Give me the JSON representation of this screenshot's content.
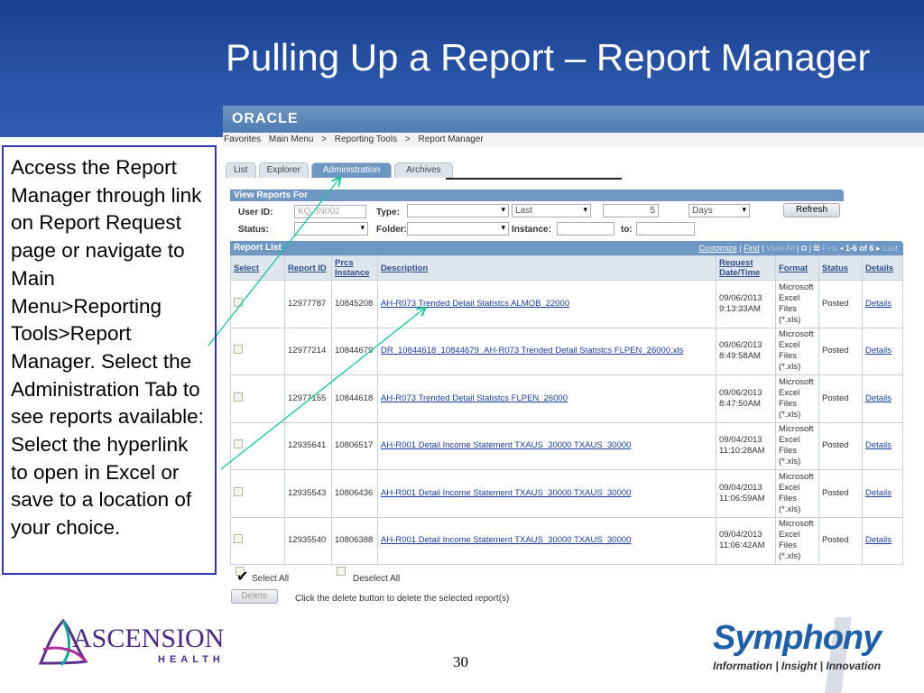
{
  "slide": {
    "title": "Pulling Up a Report – Report Manager",
    "page_number": "30",
    "callout": "Access the Report Manager through link on Report Request page or navigate to Main Menu>Reporting Tools>Report Manager. Select the Administration Tab to see reports available: Select the hyperlink to open in Excel or save to a location of your choice.",
    "logo_left": "ASCENSION HEALTH",
    "logo_left_main": "ASCENSION",
    "logo_left_sub": "HEALTH",
    "logo_right": "Symphony",
    "logo_right_tagline": "Information | Insight | Innovation"
  },
  "app": {
    "logo": "ORACLE",
    "breadcrumb": [
      "Favorites",
      "Main Menu",
      ">",
      "Reporting Tools",
      ">",
      "Report Manager"
    ],
    "tabs": [
      "List",
      "Explorer",
      "Administration",
      "Archives"
    ],
    "view_reports_for": {
      "title": "View Reports For",
      "user_id_label": "User ID:",
      "user_id": "KQ..IN002",
      "type_label": "Type:",
      "type": "",
      "last": "Last",
      "last_value": "5",
      "unit": "Days",
      "refresh": "Refresh",
      "status_label": "Status:",
      "status": "",
      "folder_label": "Folder:",
      "folder": "",
      "instance_label": "Instance:",
      "to_label": "to:"
    },
    "report_list": {
      "title": "Report List",
      "customize": "Customize",
      "find": "Find",
      "view_all": "View All",
      "first": "First",
      "range": "1-6 of 6",
      "last": "Last",
      "columns": [
        "Select",
        "Report ID",
        "Prcs Instance",
        "Description",
        "Request Date/Time",
        "Format",
        "Status",
        "Details"
      ],
      "rows": [
        {
          "report_id": "12977787",
          "instance": "10845208",
          "description": "AH-R073 Trended Detail Statistcs ALMOB_22000",
          "date": "09/06/2013",
          "time": "9:13:33AM",
          "format": "Microsoft Excel Files (*.xls)",
          "status": "Posted",
          "details": "Details"
        },
        {
          "report_id": "12977214",
          "instance": "10844679",
          "description": "DR_10844618_10844679_AH-R073 Trended Detail Statistcs FLPEN_26000.xls",
          "date": "09/06/2013",
          "time": "8:49:58AM",
          "format": "Microsoft Excel Files (*.xls)",
          "status": "Posted",
          "details": "Details"
        },
        {
          "report_id": "12977155",
          "instance": "10844618",
          "description": "AH-R073 Trended Detail Statistcs FLPEN_26000",
          "date": "09/06/2013",
          "time": "8:47:50AM",
          "format": "Microsoft Excel Files (*.xls)",
          "status": "Posted",
          "details": "Details"
        },
        {
          "report_id": "12935641",
          "instance": "10806517",
          "description": "AH-R001 Detail Income Statement TXAUS_30000 TXAUS_30000",
          "date": "09/04/2013",
          "time": "11:10:28AM",
          "format": "Microsoft Excel Files (*.xls)",
          "status": "Posted",
          "details": "Details"
        },
        {
          "report_id": "12935543",
          "instance": "10806436",
          "description": "AH-R001 Detail Income Statement TXAUS_30000 TXAUS_30000",
          "date": "09/04/2013",
          "time": "11:06:59AM",
          "format": "Microsoft Excel Files (*.xls)",
          "status": "Posted",
          "details": "Details"
        },
        {
          "report_id": "12935540",
          "instance": "10806388",
          "description": "AH-R001 Detail Income Statement TXAUS_30000 TXAUS_30000",
          "date": "09/04/2013",
          "time": "11:06:42AM",
          "format": "Microsoft Excel Files (*.xls)",
          "status": "Posted",
          "details": "Details"
        }
      ]
    },
    "select_all": "Select All",
    "deselect_all": "Deselect All",
    "delete": "Delete",
    "delete_hint": "Click the delete button to delete the selected report(s)"
  },
  "colors": {
    "band": "#1b3f8f",
    "header": "#6f97c4",
    "arrow": "#19c49a",
    "callout_border": "#3337b5"
  }
}
